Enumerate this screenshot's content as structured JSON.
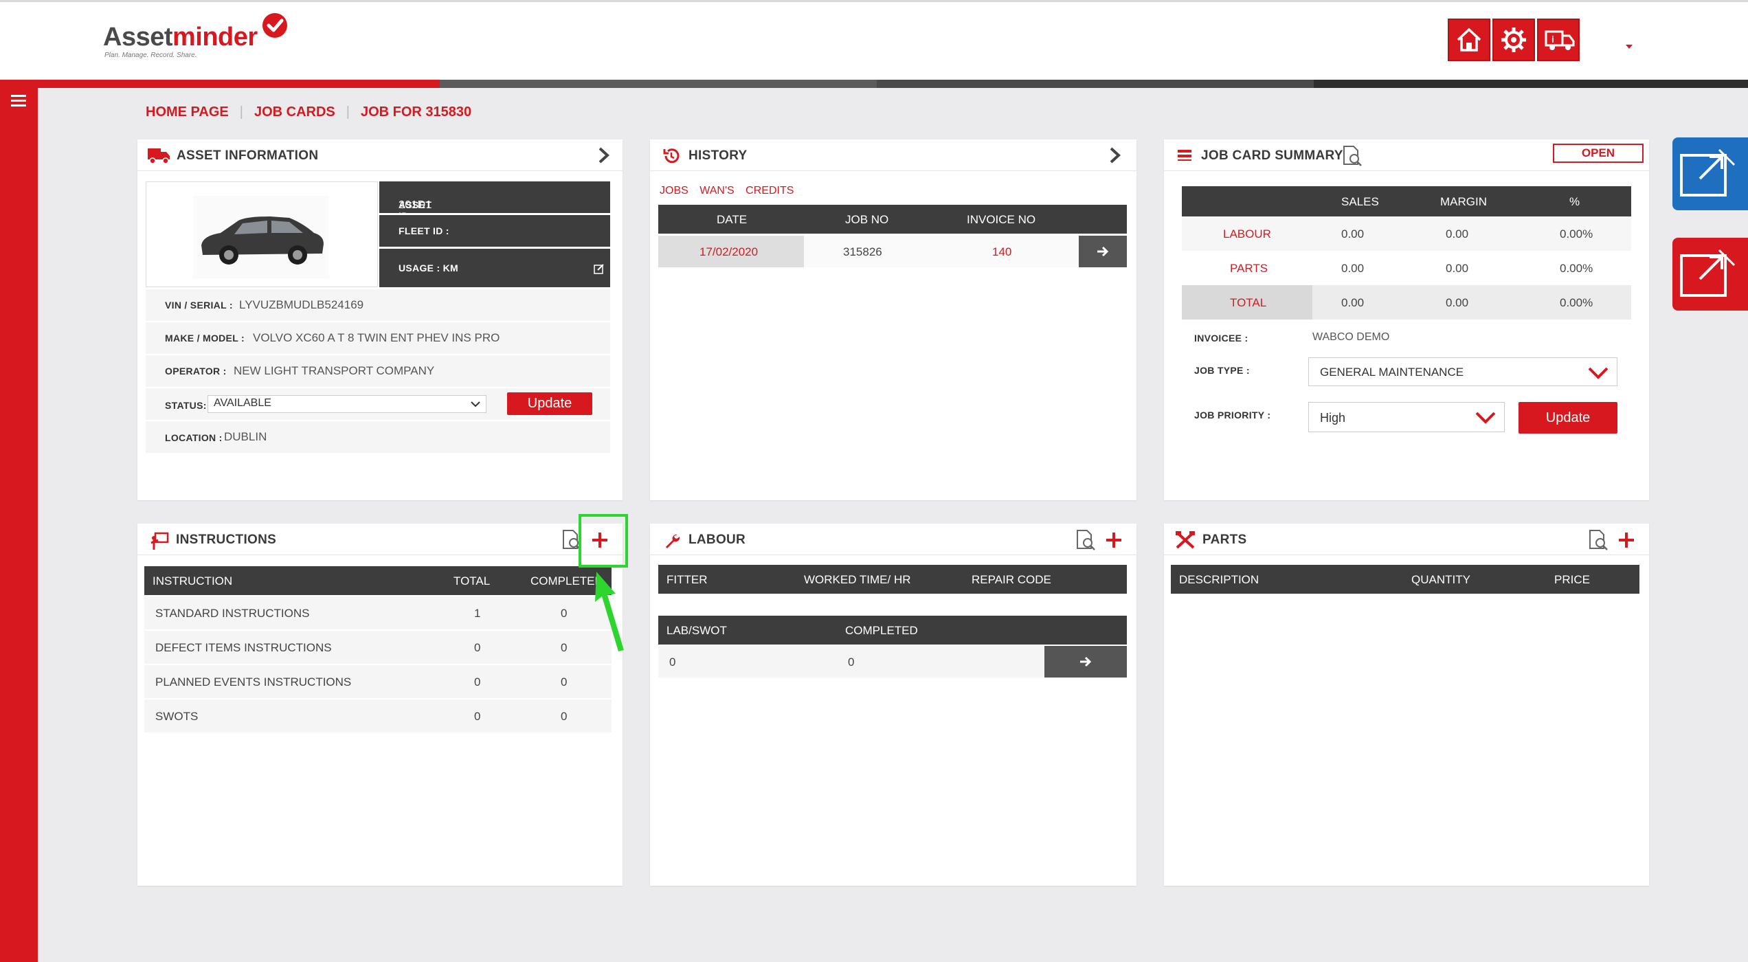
{
  "logo": {
    "brand_part1": "Asset",
    "brand_part2": "minder",
    "tagline": "Plan. Manage. Record. Share."
  },
  "header_buttons": [
    "home-icon",
    "gear-icon",
    "truck-icon"
  ],
  "colors": {
    "brand_red": "#d7191f",
    "dark": "#3d3d3d",
    "blue_tab": "#1f6fc1"
  },
  "breadcrumb": {
    "home": "HOME PAGE",
    "job_cards": "JOB CARDS",
    "current": "JOB FOR 315830"
  },
  "asset_info": {
    "title": "ASSET INFORMATION",
    "asset_id_label": "ASSET ID :",
    "asset_id": "201D1",
    "fleet_id_label": "FLEET ID :",
    "fleet_id": "",
    "usage_label": "USAGE : KM",
    "vin_label": "VIN / SERIAL :",
    "vin": "LYVUZBMUDLB524169",
    "make_label": "MAKE / MODEL :",
    "make": "VOLVO XC60 A T 8 TWIN ENT PHEV INS PRO",
    "operator_label": "OPERATOR :",
    "operator": "NEW LIGHT TRANSPORT COMPANY",
    "status_label": "STATUS:",
    "status_value": "AVAILABLE",
    "update_label": "Update",
    "location_label": "LOCATION :",
    "location": "DUBLIN"
  },
  "history": {
    "title": "HISTORY",
    "tabs": [
      "JOBS",
      "WAN'S",
      "CREDITS"
    ],
    "columns": [
      "DATE",
      "JOB NO",
      "INVOICE NO"
    ],
    "rows": [
      {
        "date": "17/02/2020",
        "job_no": "315826",
        "invoice_no": "140"
      }
    ]
  },
  "summary": {
    "title": "JOB CARD SUMMARY",
    "status_badge": "OPEN",
    "columns": [
      "SALES",
      "MARGIN",
      "%"
    ],
    "rows": [
      {
        "label": "LABOUR",
        "sales": "0.00",
        "margin": "0.00",
        "pct": "0.00%"
      },
      {
        "label": "PARTS",
        "sales": "0.00",
        "margin": "0.00",
        "pct": "0.00%"
      },
      {
        "label": "TOTAL",
        "sales": "0.00",
        "margin": "0.00",
        "pct": "0.00%"
      }
    ],
    "invoicee_label": "INVOICEE :",
    "invoicee": "WABCO DEMO",
    "job_type_label": "JOB TYPE :",
    "job_type": "GENERAL MAINTENANCE",
    "priority_label": "JOB PRIORITY :",
    "priority": "High",
    "update_label": "Update"
  },
  "instructions": {
    "title": "INSTRUCTIONS",
    "columns": [
      "INSTRUCTION",
      "TOTAL",
      "COMPLETED"
    ],
    "rows": [
      {
        "name": "STANDARD INSTRUCTIONS",
        "total": "1",
        "completed": "0"
      },
      {
        "name": "DEFECT ITEMS INSTRUCTIONS",
        "total": "0",
        "completed": "0"
      },
      {
        "name": "PLANNED EVENTS INSTRUCTIONS",
        "total": "0",
        "completed": "0"
      },
      {
        "name": "SWOTS",
        "total": "0",
        "completed": "0"
      }
    ]
  },
  "labour": {
    "title": "LABOUR",
    "columns": [
      "FITTER",
      "WORKED TIME/ HR",
      "REPAIR CODE"
    ],
    "sub_columns": [
      "LAB/SWOT",
      "COMPLETED"
    ],
    "sub_row": {
      "lab_swot": "0",
      "completed": "0"
    }
  },
  "parts": {
    "title": "PARTS",
    "columns": [
      "DESCRIPTION",
      "QUANTITY",
      "PRICE"
    ]
  }
}
